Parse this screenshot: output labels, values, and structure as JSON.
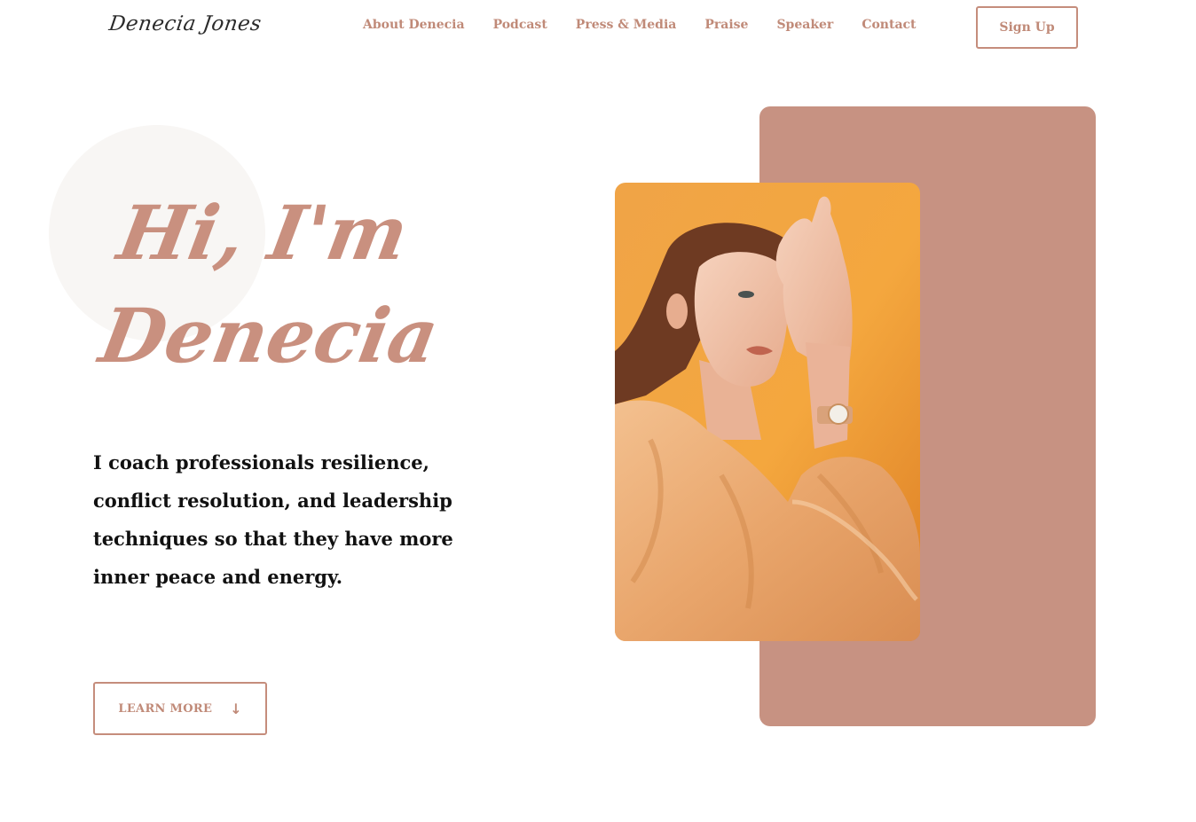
{
  "header": {
    "logo": "Denecia Jones",
    "nav": [
      {
        "label": "About Denecia"
      },
      {
        "label": "Podcast"
      },
      {
        "label": "Press & Media"
      },
      {
        "label": "Praise"
      },
      {
        "label": "Speaker"
      },
      {
        "label": "Contact"
      }
    ],
    "signup_label": "Sign Up"
  },
  "hero": {
    "title_line1": "Hi, I'm",
    "title_line2": "Denecia",
    "tagline": "I coach professionals resilience, conflict resolution, and leadership techniques so that they have more inner peace and energy.",
    "cta_label": "LEARN MORE",
    "cta_icon": "arrow-down-icon"
  },
  "colors": {
    "accent": "#c08a78",
    "panel": "#c79282",
    "circle": "#f8f6f4",
    "photo_bg": "#ee9a36"
  }
}
